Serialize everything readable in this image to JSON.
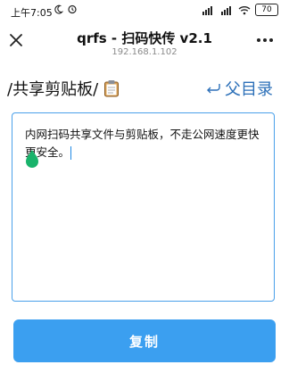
{
  "status_bar": {
    "time": "上午7:05",
    "battery": "70"
  },
  "header": {
    "title": "qrfs - 扫码快传 v2.1",
    "subtitle": "192.168.1.102"
  },
  "page": {
    "heading": "/共享剪贴板/",
    "parent_link": "父目录"
  },
  "clipboard": {
    "content": "内网扫码共享文件与剪贴板，不走公网速度更快更安全。"
  },
  "actions": {
    "copy_label": "复制"
  },
  "colors": {
    "accent": "#3b9ff0",
    "link": "#2b6fb8",
    "caret_handle": "#19b36b"
  }
}
